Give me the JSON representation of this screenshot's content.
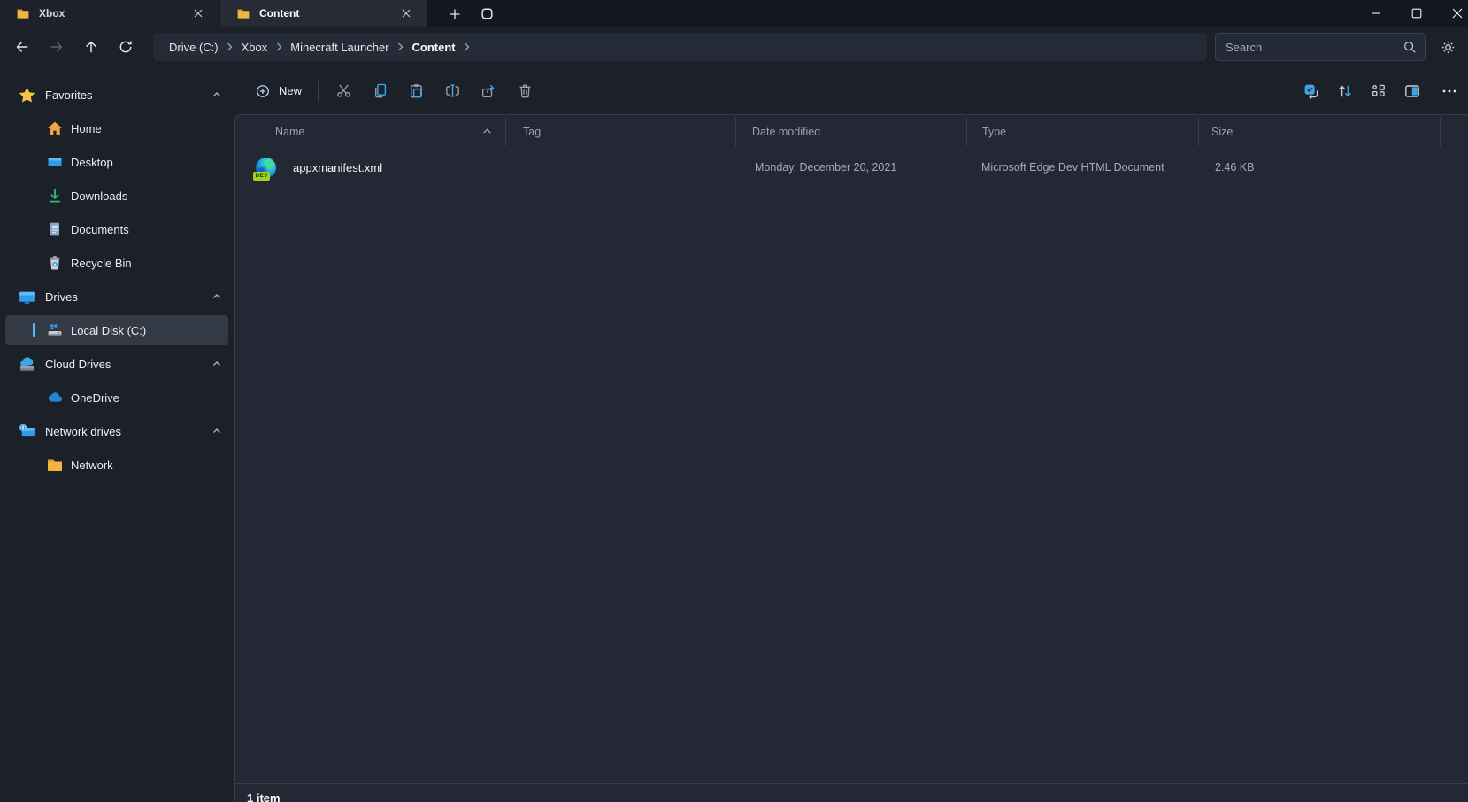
{
  "titlebar": {
    "tabs": [
      {
        "label": "Xbox",
        "active": false
      },
      {
        "label": "Content",
        "active": true
      }
    ]
  },
  "navbar": {
    "breadcrumb": {
      "segments": [
        "Drive (C:)",
        "Xbox",
        "Minecraft Launcher",
        "Content"
      ]
    },
    "search_placeholder": "Search"
  },
  "toolbar": {
    "new_label": "New"
  },
  "sidebar": {
    "sections": [
      {
        "label": "Favorites",
        "items": [
          {
            "label": "Home"
          },
          {
            "label": "Desktop"
          },
          {
            "label": "Downloads"
          },
          {
            "label": "Documents"
          },
          {
            "label": "Recycle Bin"
          }
        ]
      },
      {
        "label": "Drives",
        "items": [
          {
            "label": "Local Disk (C:)",
            "selected": true
          }
        ]
      },
      {
        "label": "Cloud Drives",
        "items": [
          {
            "label": "OneDrive"
          }
        ]
      },
      {
        "label": "Network drives",
        "items": [
          {
            "label": "Network"
          }
        ]
      }
    ]
  },
  "file_list": {
    "columns": [
      {
        "label": "Name"
      },
      {
        "label": "Tag"
      },
      {
        "label": "Date modified"
      },
      {
        "label": "Type"
      },
      {
        "label": "Size"
      }
    ],
    "rows": [
      {
        "name": "appxmanifest.xml",
        "tag": "",
        "date_modified": "Monday, December 20, 2021",
        "type": "Microsoft Edge Dev HTML Document",
        "size": "2.46 KB",
        "icon_badge": "DEV"
      }
    ],
    "status": "1 item"
  },
  "colors": {
    "accent": "#55bdf7",
    "icon_blue": "#3fa3e8",
    "folder": "#f2b53d"
  }
}
